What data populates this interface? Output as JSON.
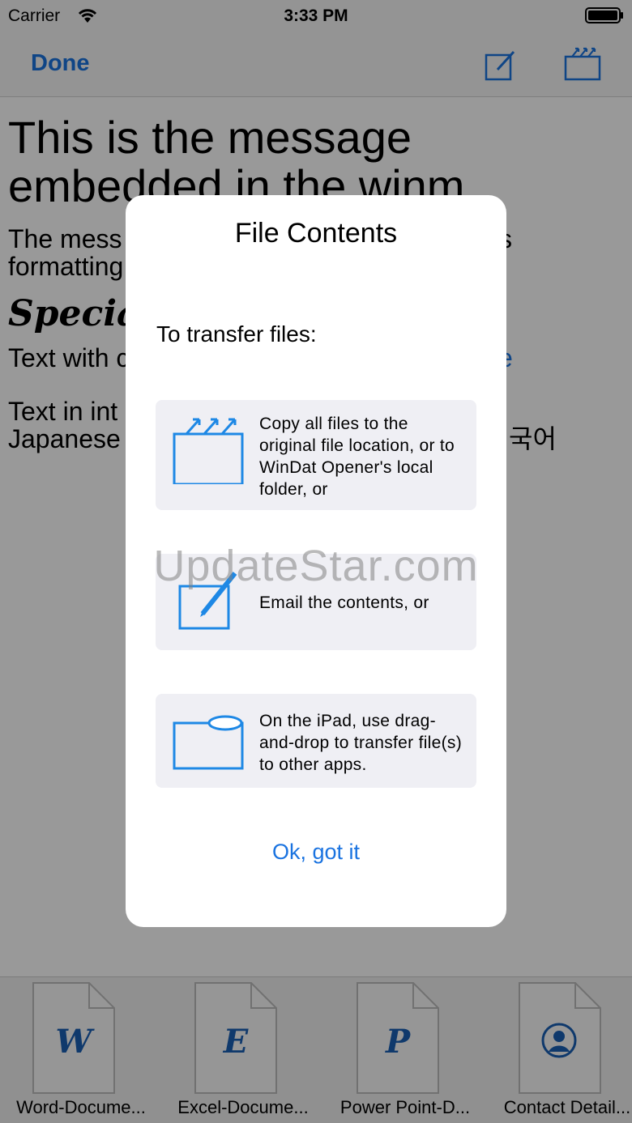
{
  "status_bar": {
    "carrier": "Carrier",
    "time": "3:33 PM"
  },
  "nav_bar": {
    "done_label": "Done"
  },
  "message": {
    "title": "This is the message embedded in the winm",
    "line1": "The mess",
    "line1_tail": "s",
    "line2": "formatting",
    "special": "Specia",
    "line3": "Text with c",
    "line3_tail": "e",
    "line4": "Text in int",
    "line5": "Japanese",
    "line5_tail": "국어"
  },
  "attachments": [
    {
      "letter": "W",
      "label": "Word-Docume..."
    },
    {
      "letter": "E",
      "label": "Excel-Docume..."
    },
    {
      "letter": "P",
      "label": "Power Point-D..."
    },
    {
      "letter": "",
      "label": "Contact Detail..."
    }
  ],
  "dialog": {
    "title": "File Contents",
    "subtitle": "To transfer files:",
    "options": [
      {
        "icon": "share-folder-icon",
        "text": "Copy all files to the original file location, or to WinDat Opener's local folder, or"
      },
      {
        "icon": "compose-icon",
        "text": "Email the contents, or"
      },
      {
        "icon": "drag-drop-icon",
        "text": "On the iPad, use drag-and-drop to transfer file(s) to other apps."
      }
    ],
    "ok_label": "Ok, got it"
  },
  "watermark": "UpdateStar.com",
  "colors": {
    "accent": "#1a73e0",
    "icon_blue": "#1e88e5"
  }
}
